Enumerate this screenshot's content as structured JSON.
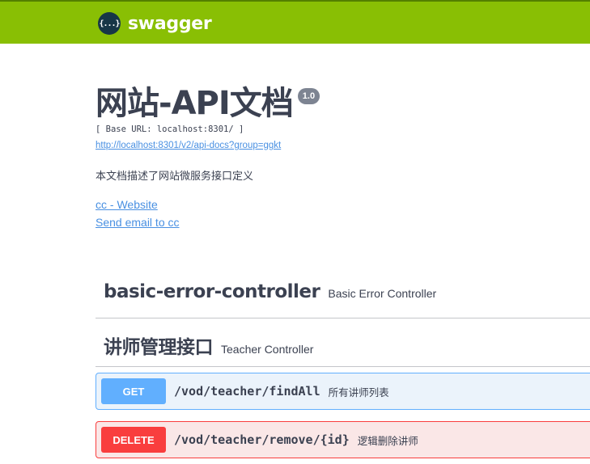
{
  "topbar": {
    "logo_glyph": "{...}",
    "logo_text": "swagger",
    "color": "#89bf04"
  },
  "info": {
    "title": "网站-API文档",
    "version": "1.0",
    "base_url": "[ Base URL: localhost:8301/ ]",
    "api_docs_link": "http://localhost:8301/v2/api-docs?group=ggkt",
    "description": "本文档描述了网站微服务接口定义",
    "contact_website": "cc - Website",
    "contact_email": "Send email to cc"
  },
  "tags": [
    {
      "name": "basic-error-controller",
      "description": "Basic Error Controller"
    },
    {
      "name": "讲师管理接口",
      "description": "Teacher Controller"
    }
  ],
  "operations": [
    {
      "method": "GET",
      "path": "/vod/teacher/findAll",
      "summary": "所有讲师列表",
      "color": "#61affe"
    },
    {
      "method": "DELETE",
      "path": "/vod/teacher/remove/{id}",
      "summary": "逻辑删除讲师",
      "color": "#f93e3e"
    }
  ]
}
